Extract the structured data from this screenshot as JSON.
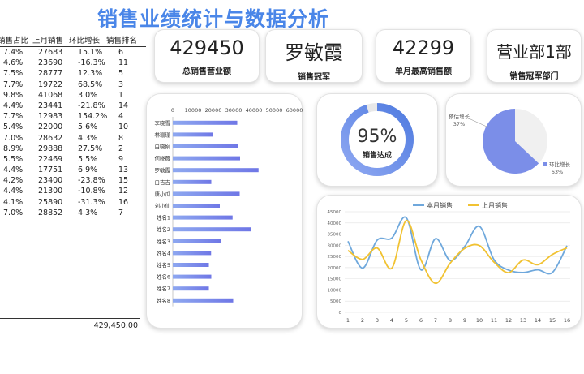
{
  "title": "销售业绩统计与数据分析",
  "table": {
    "headers": [
      "销售占比",
      "上月销售",
      "环比增长",
      "销售排名"
    ],
    "rows": [
      [
        "7.4%",
        "27683",
        "15.1%",
        "6"
      ],
      [
        "4.6%",
        "23690",
        "-16.3%",
        "11"
      ],
      [
        "7.5%",
        "28777",
        "12.3%",
        "5"
      ],
      [
        "7.7%",
        "19722",
        "68.5%",
        "3"
      ],
      [
        "9.8%",
        "41068",
        "3.0%",
        "1"
      ],
      [
        "4.4%",
        "23441",
        "-21.8%",
        "14"
      ],
      [
        "7.7%",
        "12983",
        "154.2%",
        "4"
      ],
      [
        "5.4%",
        "22000",
        "5.6%",
        "10"
      ],
      [
        "7.0%",
        "28632",
        "4.3%",
        "8"
      ],
      [
        "8.9%",
        "29888",
        "27.5%",
        "2"
      ],
      [
        "5.5%",
        "22469",
        "5.5%",
        "9"
      ],
      [
        "4.4%",
        "17751",
        "6.9%",
        "13"
      ],
      [
        "4.2%",
        "23400",
        "-23.8%",
        "15"
      ],
      [
        "4.4%",
        "21300",
        "-10.8%",
        "12"
      ],
      [
        "4.1%",
        "25890",
        "-31.3%",
        "16"
      ],
      [
        "7.0%",
        "28852",
        "4.3%",
        "7"
      ]
    ],
    "total": "429,450.00"
  },
  "kpis": [
    {
      "value": "429450",
      "label": "总销售营业额"
    },
    {
      "value": "罗敏霞",
      "label": "销售冠军"
    },
    {
      "value": "42299",
      "label": "单月最高销售额"
    },
    {
      "value": "营业部1部",
      "label": "销售冠军部门"
    }
  ],
  "colors": {
    "accent": "#4a86e8",
    "bar_start": "#8ea8f0",
    "bar_end": "#6f77e6",
    "line_current": "#6fa8dc",
    "line_last": "#f1c232",
    "pie_grey": "#f0f0f0",
    "pie_blue": "#7b8ee8"
  },
  "donut": {
    "value": 0.95,
    "value_label": "95%",
    "label": "销售达成"
  },
  "chart_data": [
    {
      "type": "bar",
      "orientation": "horizontal",
      "categories": [
        "李晓雪",
        "林珊珊",
        "白晓娟",
        "何晓薇",
        "罗敏霞",
        "白吉吉",
        "唐小瓜",
        "刘小仙",
        "姓名1",
        "姓名2",
        "姓名3",
        "姓名4",
        "姓名5",
        "姓名6",
        "姓名7",
        "姓名8"
      ],
      "values": [
        31800,
        19800,
        32300,
        33200,
        42299,
        19000,
        33000,
        23200,
        29500,
        38500,
        23600,
        18900,
        17800,
        19000,
        17800,
        29800
      ],
      "xlim": [
        0,
        60000
      ],
      "xticks": [
        0,
        10000,
        20000,
        30000,
        40000,
        50000,
        60000
      ],
      "grid": false
    },
    {
      "type": "pie",
      "labels": [
        "预估增长",
        "环比增长"
      ],
      "values": [
        37,
        63
      ],
      "value_labels": [
        "37%",
        "63%"
      ]
    },
    {
      "type": "line",
      "x": [
        1,
        2,
        3,
        4,
        5,
        6,
        7,
        8,
        9,
        10,
        11,
        12,
        13,
        14,
        15,
        16
      ],
      "series": [
        {
          "name": "本月销售",
          "values": [
            31800,
            19800,
            32300,
            33200,
            42299,
            19000,
            33000,
            23200,
            29500,
            38500,
            23600,
            18900,
            17800,
            19000,
            17800,
            29800
          ]
        },
        {
          "name": "上月销售",
          "values": [
            27683,
            23690,
            28777,
            19722,
            41068,
            23441,
            12983,
            22000,
            28632,
            29888,
            22469,
            17751,
            23400,
            21300,
            25890,
            28852
          ]
        }
      ],
      "ylim": [
        0,
        45000
      ],
      "yticks": [
        0,
        5000,
        10000,
        15000,
        20000,
        25000,
        30000,
        35000,
        40000,
        45000
      ],
      "grid": true,
      "legend": "top"
    }
  ]
}
